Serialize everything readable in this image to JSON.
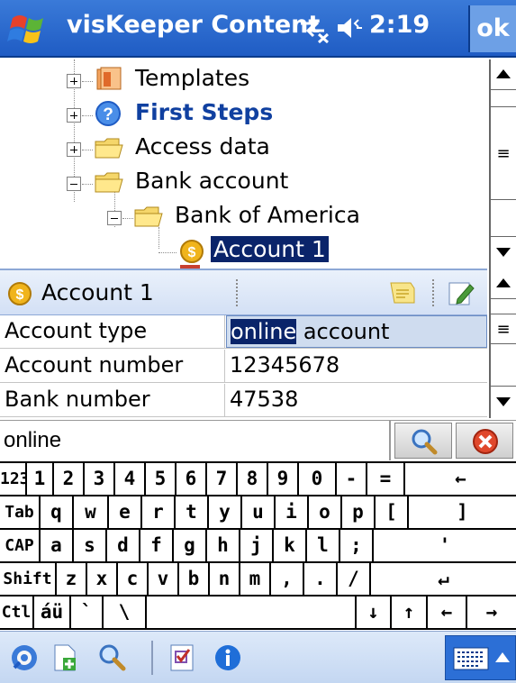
{
  "titlebar": {
    "app_title": "visKeeper Content",
    "time": "2:19",
    "ok_label": "ok"
  },
  "tree": {
    "items": [
      {
        "label": "Templates",
        "icon": "templates-folder-icon",
        "expanded": false
      },
      {
        "label": "First Steps",
        "icon": "help-icon",
        "expanded": false
      },
      {
        "label": "Access data",
        "icon": "folder-icon",
        "expanded": false
      },
      {
        "label": "Bank account",
        "icon": "folder-icon",
        "expanded": true
      },
      {
        "label": "Bank of America",
        "icon": "folder-icon",
        "expanded": true
      },
      {
        "label": "Account 1",
        "icon": "coin-icon",
        "selected": true
      }
    ]
  },
  "detail": {
    "title": "Account 1",
    "rows": [
      {
        "key": "Account type",
        "value_selected": "online",
        "value_rest": " account"
      },
      {
        "key": "Account number",
        "value": "12345678"
      },
      {
        "key": "Bank number",
        "value": "47538"
      }
    ]
  },
  "search": {
    "value": "online"
  },
  "keyboard": {
    "row1": [
      "123",
      "1",
      "2",
      "3",
      "4",
      "5",
      "6",
      "7",
      "8",
      "9",
      "0",
      "-",
      "=",
      "←"
    ],
    "row2": [
      "Tab",
      "q",
      "w",
      "e",
      "r",
      "t",
      "y",
      "u",
      "i",
      "o",
      "p",
      "[",
      "]"
    ],
    "row3": [
      "CAP",
      "a",
      "s",
      "d",
      "f",
      "g",
      "h",
      "j",
      "k",
      "l",
      ";",
      "'"
    ],
    "row4": [
      "Shift",
      "z",
      "x",
      "c",
      "v",
      "b",
      "n",
      "m",
      ",",
      ".",
      "/",
      "↵"
    ],
    "row5": [
      "Ctl",
      "áü",
      "`",
      "\\",
      "",
      "↓",
      "↑",
      "←",
      "→"
    ]
  },
  "colors": {
    "titlebar": "#1f5cc4",
    "selection": "#0a246a",
    "header_bar": "#d3e0f5"
  }
}
